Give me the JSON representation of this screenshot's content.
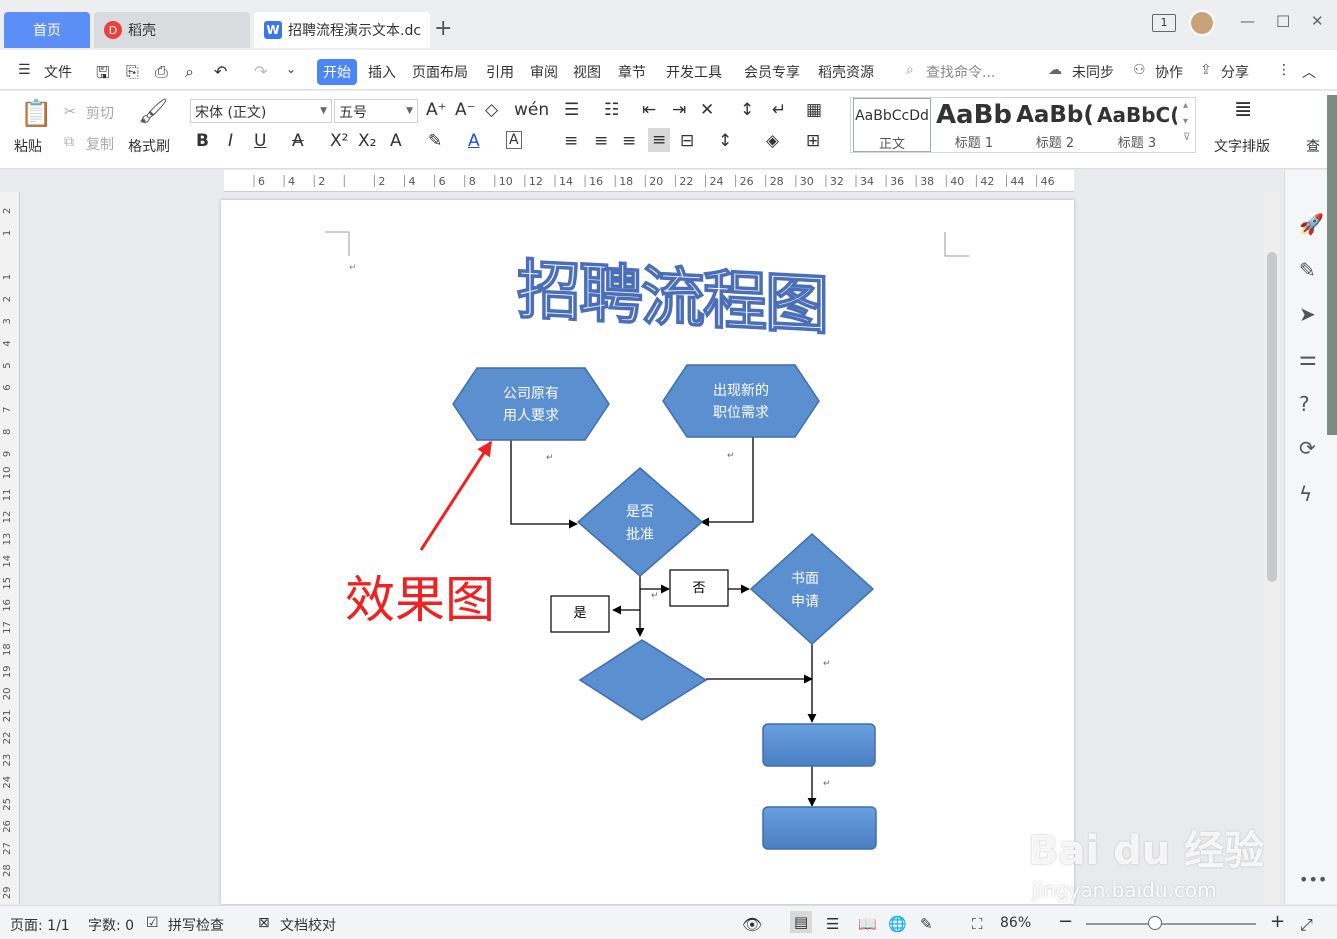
{
  "tabs": {
    "home": "首页",
    "daoke": "稻壳",
    "doc": "招聘流程演示文本.dc",
    "new_tab": "+"
  },
  "window": {
    "badge": "1",
    "min": "—",
    "max": "☐",
    "close": "✕"
  },
  "menu": {
    "file": "文件",
    "items": [
      "开始",
      "插入",
      "页面布局",
      "引用",
      "审阅",
      "视图",
      "章节",
      "开发工具",
      "会员专享",
      "稻壳资源"
    ],
    "search": "查找命令...",
    "sync": "未同步",
    "collab": "协作",
    "share": "分享"
  },
  "ribbon": {
    "paste": "粘贴",
    "cut": "剪切",
    "copy": "复制",
    "format_painter": "格式刷",
    "font": "宋体 (正文)",
    "size": "五号",
    "text_layout": "文字排版",
    "find_cut": "查",
    "styles": [
      {
        "preview": "AaBbCcDd",
        "name": "正文"
      },
      {
        "preview": "AaBb",
        "name": "标题 1"
      },
      {
        "preview": "AaBb(",
        "name": "标题 2"
      },
      {
        "preview": "AaBbC(",
        "name": "标题 3"
      }
    ]
  },
  "ruler": {
    "ticks": [
      "6",
      "4",
      "2",
      "",
      "2",
      "4",
      "6",
      "8",
      "10",
      "12",
      "14",
      "16",
      "18",
      "20",
      "22",
      "24",
      "26",
      "28",
      "30",
      "32",
      "34",
      "36",
      "38",
      "40",
      "42",
      "44",
      "46"
    ],
    "vticks": [
      "2",
      "1",
      "",
      "1",
      "2",
      "3",
      "4",
      "5",
      "6",
      "7",
      "8",
      "9",
      "10",
      "11",
      "12",
      "13",
      "14",
      "15",
      "16",
      "17",
      "18",
      "19",
      "20",
      "21",
      "22",
      "23",
      "24",
      "25",
      "26",
      "27",
      "28",
      "29"
    ]
  },
  "doc": {
    "title": "招聘流程图",
    "effect_label": "效果图",
    "shapes": {
      "hex1": [
        "公司原有",
        "用人要求"
      ],
      "hex2": [
        "出现新的",
        "职位需求"
      ],
      "diamond1": [
        "是否",
        "批准"
      ],
      "no_box": "否",
      "yes_box": "是",
      "diamond2": [
        "书面",
        "申请"
      ]
    },
    "colors": {
      "shape_fill": "#5b8fd0",
      "shape_stroke": "#3f6fa8",
      "annotation": "#ee2222"
    }
  },
  "watermark": {
    "brand": "Bai du 经验",
    "url": "jingyan.baidu.com"
  },
  "status": {
    "page": "页面: 1/1",
    "words": "字数: 0",
    "spell": "拼写检查",
    "proof": "文档校对",
    "zoom": "86%"
  }
}
